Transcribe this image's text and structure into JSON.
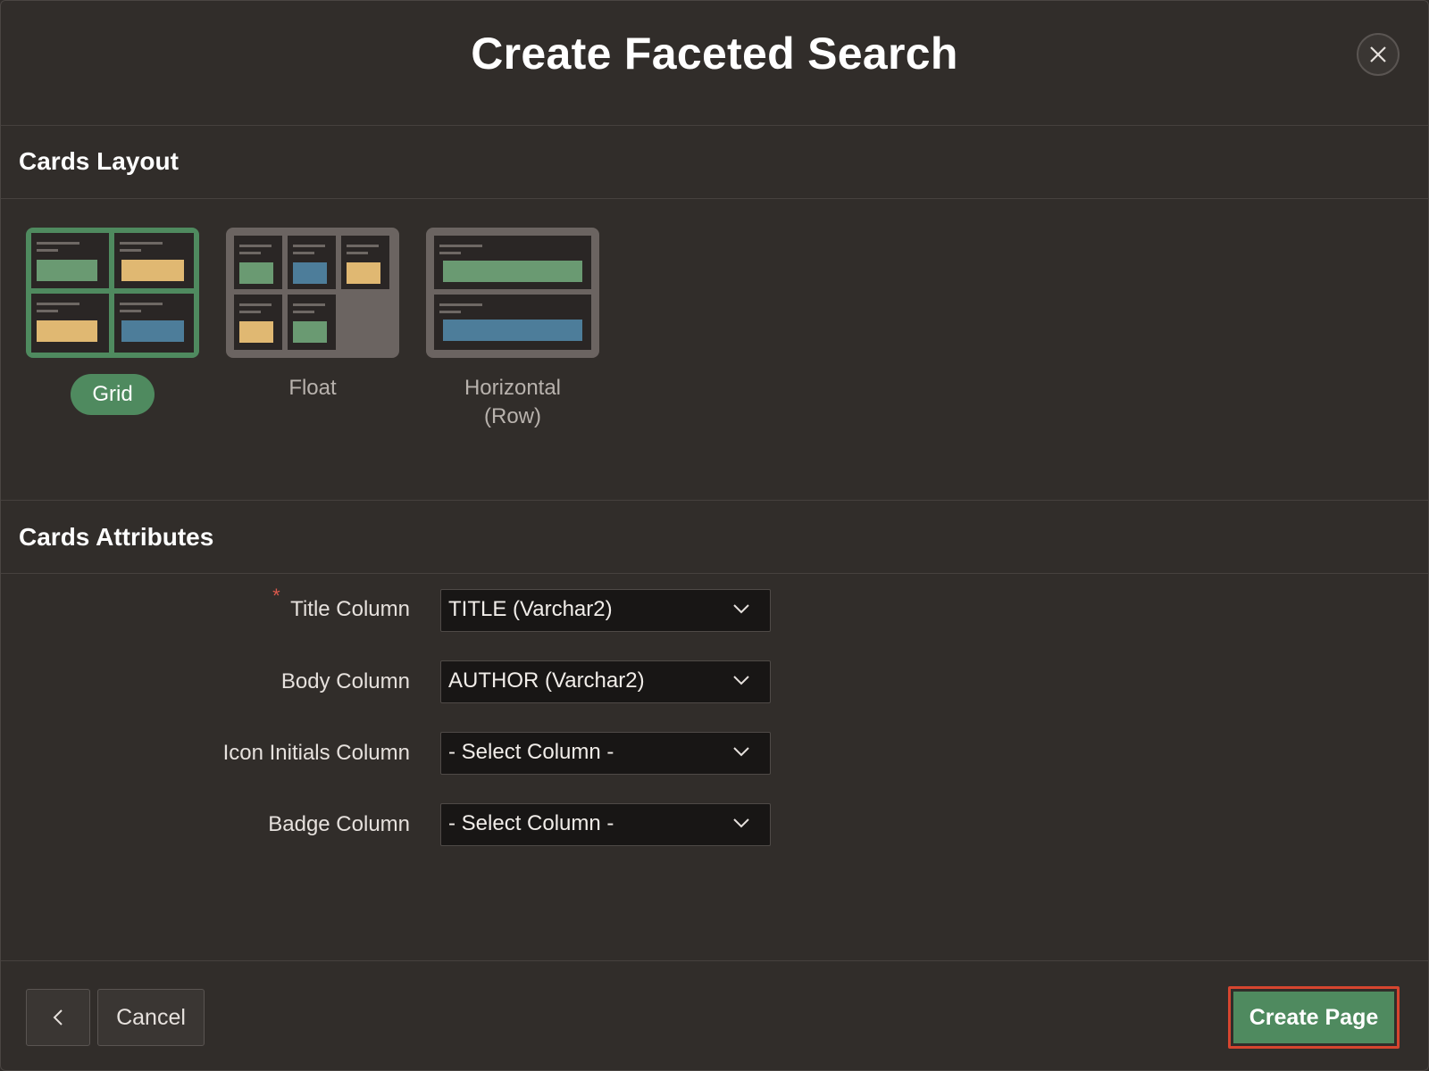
{
  "dialog": {
    "title": "Create Faceted Search",
    "close_icon": "close-icon"
  },
  "cards_layout": {
    "heading": "Cards Layout",
    "options": [
      {
        "label": "Grid",
        "selected": true
      },
      {
        "label": "Float",
        "selected": false
      },
      {
        "label_line1": "Horizontal",
        "label_line2": "(Row)",
        "selected": false
      }
    ]
  },
  "cards_attributes": {
    "heading": "Cards Attributes",
    "required_marker": "*",
    "fields": [
      {
        "label": "Title Column",
        "value": "TITLE (Varchar2)",
        "required": true
      },
      {
        "label": "Body Column",
        "value": "AUTHOR (Varchar2)"
      },
      {
        "label": "Icon Initials Column",
        "value": "- Select Column -"
      },
      {
        "label": "Badge Column",
        "value": "- Select Column -"
      }
    ]
  },
  "footer": {
    "back_icon": "chevron-left-icon",
    "cancel_label": "Cancel",
    "create_label": "Create Page"
  },
  "colors": {
    "accent_green": "#4f8a5f",
    "highlight_red": "#d6452f",
    "background": "#312d2a"
  }
}
